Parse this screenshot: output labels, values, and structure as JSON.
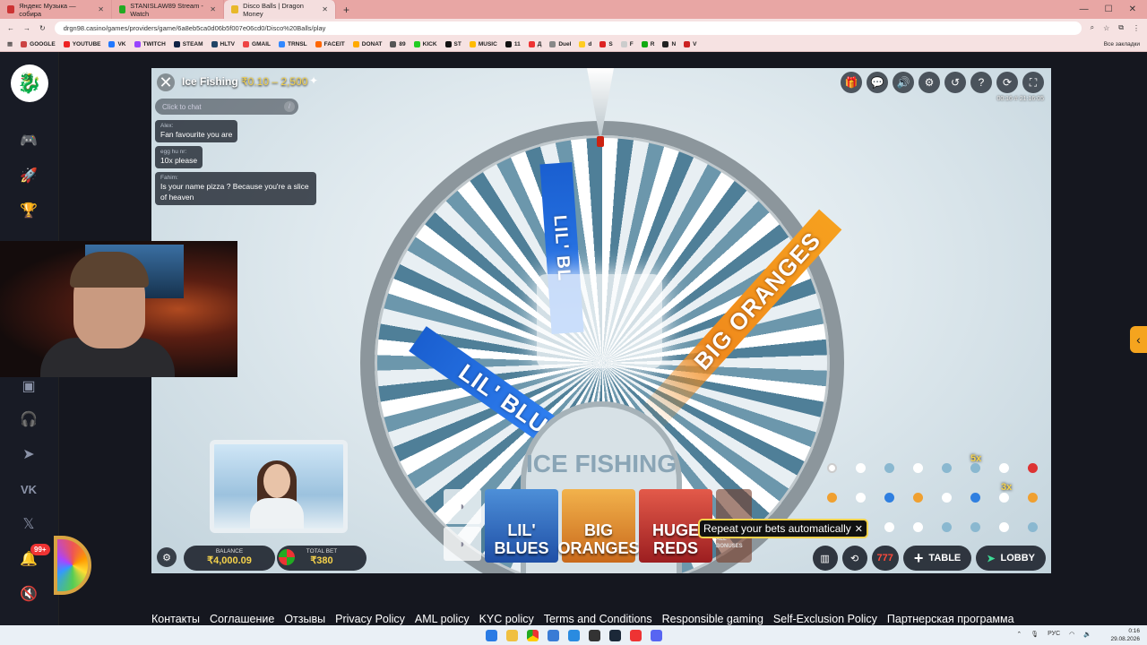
{
  "browser": {
    "tabs": [
      {
        "label": "Яндекс Музыка — собира",
        "color": "#d33"
      },
      {
        "label": "STANISLAW89 Stream - Watch",
        "color": "#2a2"
      },
      {
        "label": "Disco Balls | Dragon Money",
        "color": "#e8b82a"
      }
    ],
    "url": "drgn98.casino/games/providers/game/6a8eb5ca0d06b5f007e06cd0/Disco%20Balls/play",
    "bookmarks": [
      "GOOGLE",
      "YOUTUBE",
      "VK",
      "TWITCH",
      "STEAM",
      "HLTV",
      "GMAIL",
      "TRNSL",
      "FACEIT",
      "DONAT",
      "89",
      "KICK",
      "ST",
      "MUSIC",
      "11",
      "Д",
      "Duel",
      "d",
      "S",
      "F",
      "R",
      "N",
      "V"
    ],
    "bookmarks_end": "Все закладки"
  },
  "sidebar": {
    "icons": [
      "controller-icon",
      "rocket-icon",
      "trophy-icon",
      "dot-icon",
      "gift-box-icon",
      "headset-icon",
      "telegram-icon",
      "vk-icon",
      "x-icon",
      "bell-icon",
      "mute-icon"
    ],
    "notification_count": "99+"
  },
  "game": {
    "title": "Ice Fishing",
    "limits": "₹0.10 – 2,500",
    "timer": "00:16  # 21:16:05",
    "chat_placeholder": "Click to chat",
    "messages": [
      {
        "user": "Alex:",
        "text": "Fan favourite you are"
      },
      {
        "user": "egg hu nr:",
        "text": "10x please"
      },
      {
        "user": "Fahim:",
        "text": "Is your name pizza ? Because you're a slice of heaven"
      }
    ],
    "wheel": {
      "segment_blue_1": "LIL' BLUES",
      "segment_blue_2": "LIL' BL",
      "segment_orange": "BIG ORANGES",
      "hub_text": "ICE FISHING"
    },
    "balance_label": "BALANCE",
    "balance": "₹4,000.09",
    "total_bet_label": "TOTAL BET",
    "total_bet": "₹380",
    "bet_cards": [
      {
        "line1": "LIL'",
        "line2": "BLUES"
      },
      {
        "line1": "BIG",
        "line2": "ORANGES"
      },
      {
        "line1": "HUGE",
        "line2": "REDS"
      }
    ],
    "all_bonuses": "ALL BONUSES",
    "tooltip": "Repeat your bets automatically",
    "multipliers": [
      "5x",
      "3x"
    ],
    "buttons": {
      "table": "TABLE",
      "lobby": "LOBBY",
      "slot": "777"
    }
  },
  "footer_links": [
    "Контакты",
    "Соглашение",
    "Отзывы",
    "Privacy Policy",
    "AML policy",
    "KYC policy",
    "Terms and Conditions",
    "Responsible gaming",
    "Self-Exclusion Policy",
    "Партнерская программа"
  ],
  "taskbar": {
    "lang": "РУС",
    "time": "0:16",
    "date": "29.08.2026"
  }
}
